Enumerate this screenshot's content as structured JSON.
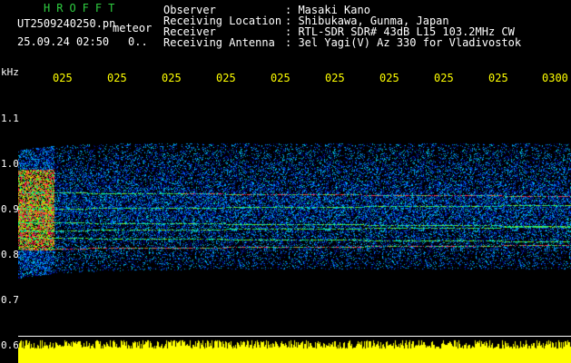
{
  "header": {
    "brand": "HROFFT",
    "filename": "UT2509240250.pn",
    "meteor_label": "meteor",
    "datetime": "25.09.24 02:50",
    "count": "0..",
    "info": [
      {
        "label": "Observer",
        "value": ": Masaki Kano"
      },
      {
        "label": "Receiving Location",
        "value": ": Shibukawa, Gunma, Japan"
      },
      {
        "label": "Receiver",
        "value": ": RTL-SDR SDR# 43dB L15 103.2MHz CW"
      },
      {
        "label": "Receiving Antenna",
        "value": ": 3el Yagi(V) Az 330 for Vladivostok"
      }
    ]
  },
  "axis": {
    "unit": "kHz",
    "y_ticks": [
      "1.1",
      "1.0",
      "0.9",
      "0.8",
      "0.7",
      "0.6"
    ],
    "x_ticks": [
      "025",
      "025",
      "025",
      "025",
      "025",
      "025",
      "025",
      "025",
      "025",
      "0300"
    ]
  },
  "colors": {
    "background": "#000000",
    "tick_text": "#ffff00",
    "brand": "#2ecc40",
    "amplitude": "#ffff00"
  }
}
